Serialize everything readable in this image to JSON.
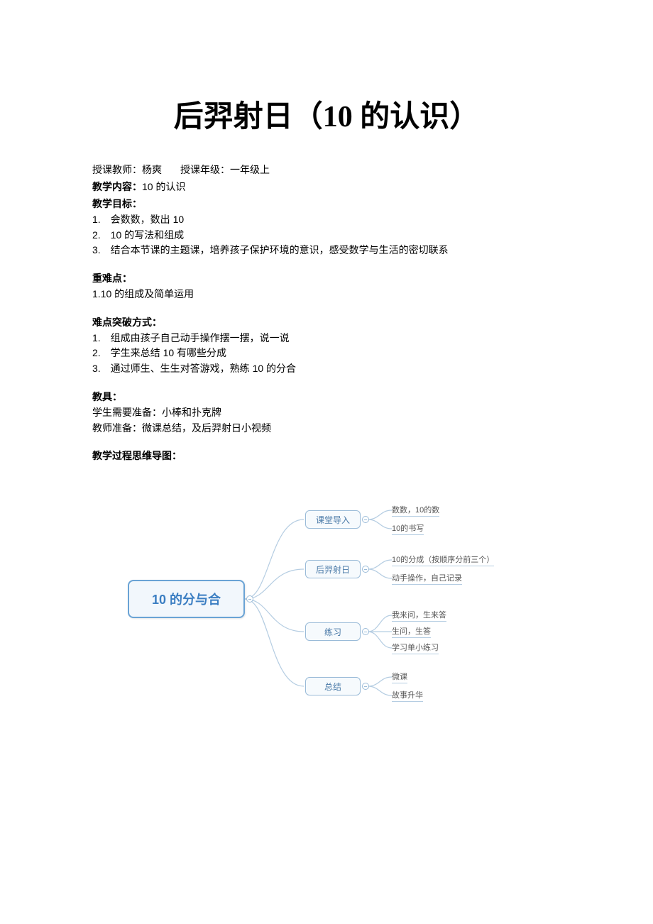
{
  "title": "后羿射日（10 的认识）",
  "meta": {
    "teacher_label": "授课教师：",
    "teacher_value": "杨爽",
    "grade_label": "授课年级：",
    "grade_value": "一年级上",
    "content_label": "教学内容：",
    "content_value": "10 的认识"
  },
  "goals": {
    "heading": "教学目标：",
    "items": [
      "1.　会数数，数出 10",
      "2.　10 的写法和组成",
      "3.　结合本节课的主题课，培养孩子保护环境的意识，感受数学与生活的密切联系"
    ]
  },
  "difficulty": {
    "heading": "重难点：",
    "item": "1.10 的组成及简单运用"
  },
  "breakthrough": {
    "heading": "难点突破方式：",
    "items": [
      "1.　组成由孩子自己动手操作摆一摆，说一说",
      "2.　学生来总结 10 有哪些分成",
      "3.　通过师生、生生对答游戏，熟练 10 的分合"
    ]
  },
  "tools": {
    "heading": "教具：",
    "student": "学生需要准备：小棒和扑克牌",
    "teacher": "教师准备：微课总结，及后羿射日小视频"
  },
  "process_heading": "教学过程思维导图：",
  "mindmap": {
    "root": "10 的分与合",
    "branches": [
      {
        "label": "课堂导入",
        "leaves": [
          "数数，10的数",
          "10的书写"
        ]
      },
      {
        "label": "后羿射日",
        "leaves": [
          "10的分成（按顺序分前三个）",
          "动手操作，自己记录"
        ]
      },
      {
        "label": "练习",
        "leaves": [
          "我来问，生来答",
          "生问，生答",
          "学习单小练习"
        ]
      },
      {
        "label": "总结",
        "leaves": [
          "微课",
          "故事升华"
        ]
      }
    ]
  }
}
